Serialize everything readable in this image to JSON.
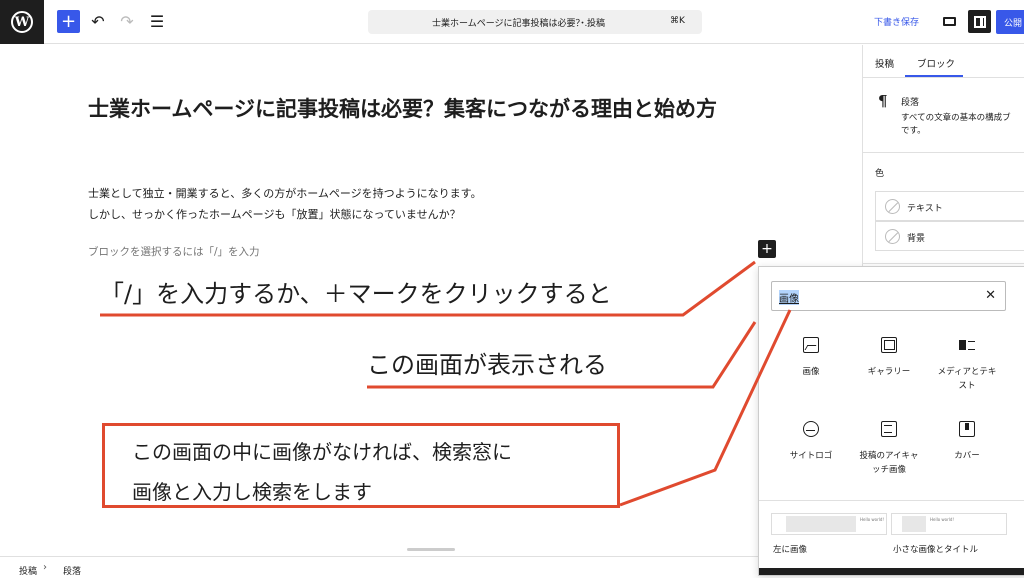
{
  "topbar": {
    "logo": "W",
    "doc_title": "士業ホームページに記事投稿は必要？...",
    "doc_type": "・投稿",
    "shortcut": "⌘K",
    "save_draft": "下書き保存",
    "publish": "公開",
    "icons": [
      "wordpress-logo",
      "plus-icon",
      "undo-icon",
      "redo-icon",
      "list-view-icon",
      "preview-icon",
      "settings-icon"
    ]
  },
  "editor": {
    "title": "士業ホームページに記事投稿は必要？集客につながる理由と始め方",
    "paragraph_1": "士業として独立・開業すると、多くの方がホームページを持つようになります。",
    "paragraph_2": "しかし、せっかく作ったホームページも「放置」状態になっていませんか？",
    "placeholder": "ブロックを選択するには「/」を入力"
  },
  "sidebar": {
    "tabs": [
      "投稿",
      "ブロック"
    ],
    "active_tab": "ブロック",
    "block_name": "段落",
    "block_desc_1": "すべての文章の基本の構成ブ",
    "block_desc_2": "です。",
    "color_label": "色",
    "color_items": [
      "テキスト",
      "背景"
    ]
  },
  "inserter": {
    "search_value": "画像",
    "blocks": [
      {
        "label": "画像",
        "icon": "image-icon"
      },
      {
        "label": "ギャラリー",
        "icon": "gallery-icon"
      },
      {
        "label": "メディアとテキ",
        "label2": "スト",
        "icon": "media-text-icon"
      },
      {
        "label": "サイトロゴ",
        "icon": "site-logo-icon"
      },
      {
        "label": "投稿のアイキャ",
        "label2": "ッチ画像",
        "icon": "featured-image-icon"
      },
      {
        "label": "カバー",
        "icon": "cover-icon"
      }
    ],
    "patterns": [
      {
        "label": "左に画像",
        "preview_text": "Hello world!"
      },
      {
        "label": "小さな画像とタイトル",
        "preview_text": "Hello world!"
      }
    ]
  },
  "footer": {
    "crumbs": [
      "投稿",
      "段落"
    ],
    "separator": "›"
  },
  "annotations": {
    "line_1": "「/」を入力するか、＋マークをクリックすると",
    "line_2": "この画面が表示される",
    "box_line_1": "この画面の中に画像がなければ、検索窓に",
    "box_line_2": "画像と入力し検索をします",
    "color": "#e04a2f"
  }
}
